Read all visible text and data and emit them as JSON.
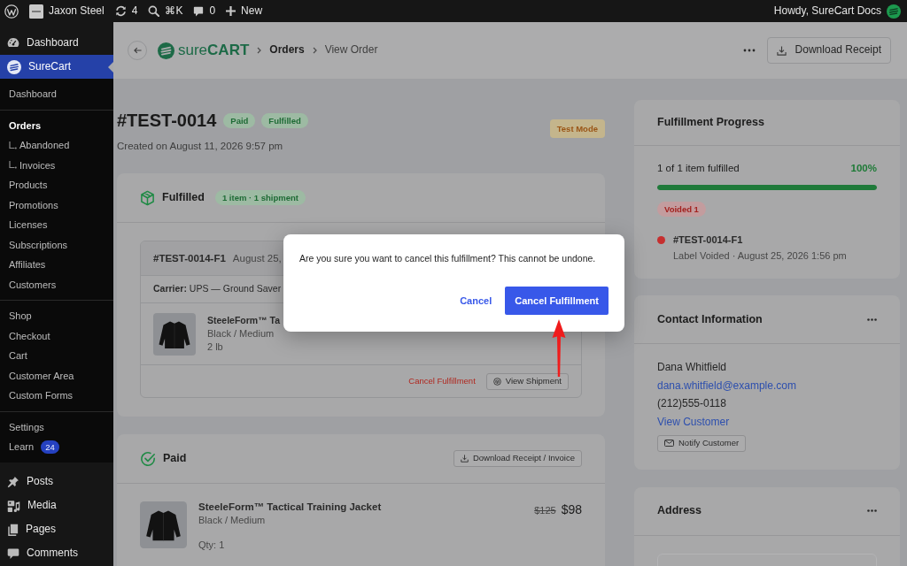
{
  "admin_bar": {
    "site_name": "Jaxon Steel",
    "updates": "4",
    "search_shortcut": "⌘K",
    "comments": "0",
    "new_label": "New",
    "greeting": "Howdy, SureCart Docs"
  },
  "sidebar": {
    "items": [
      {
        "label": "Dashboard",
        "selected": false
      },
      {
        "label": "SureCart",
        "selected": true,
        "submenu": [
          {
            "items": [
              {
                "label": "Dashboard",
                "selected": false
              }
            ]
          },
          {
            "items": [
              {
                "label": "Orders",
                "selected": true,
                "children": [
                  {
                    "label": "Abandoned",
                    "selected": false
                  },
                  {
                    "label": "Invoices",
                    "selected": false
                  }
                ]
              },
              {
                "label": "Products",
                "selected": false
              },
              {
                "label": "Promotions",
                "selected": false
              },
              {
                "label": "Licenses",
                "selected": false
              },
              {
                "label": "Subscriptions",
                "selected": false
              },
              {
                "label": "Affiliates",
                "selected": false
              },
              {
                "label": "Customers",
                "selected": false
              }
            ]
          },
          {
            "items": [
              {
                "label": "Shop",
                "selected": false
              },
              {
                "label": "Checkout",
                "selected": false
              },
              {
                "label": "Cart",
                "selected": false
              },
              {
                "label": "Customer Area",
                "selected": false
              },
              {
                "label": "Custom Forms",
                "selected": false
              }
            ]
          },
          {
            "items": [
              {
                "label": "Settings",
                "selected": false
              },
              {
                "label": "Learn",
                "selected": false,
                "badge": "24"
              }
            ]
          }
        ]
      },
      {
        "label": "Posts",
        "selected": false
      },
      {
        "label": "Media",
        "selected": false
      },
      {
        "label": "Pages",
        "selected": false
      },
      {
        "label": "Comments",
        "selected": false
      }
    ]
  },
  "header": {
    "logo_text": "sure**CART**",
    "breadcrumbs": [
      {
        "label": "Orders",
        "current": false
      },
      {
        "label": "View Order",
        "current": true
      }
    ],
    "download_button": "Download Receipt"
  },
  "order": {
    "number": "#TEST-0014",
    "badges": [
      "Paid",
      "Fulfilled"
    ],
    "mode_badge": "Test Mode",
    "created": "Created on August 11, 2026 9:57 pm"
  },
  "fulfilled_card": {
    "title": "Fulfilled",
    "pill": "1 item · 1 shipment",
    "shipment": {
      "id": "#TEST-0014-F1",
      "date": "August 25,",
      "carrier": "**Carrier:** UPS — Ground Saver",
      "item": {
        "name": "SteeleForm™ Ta",
        "variant": "Black / Medium",
        "weight": "2 lb"
      },
      "cancel_link": "Cancel Fulfillment",
      "view_button": "View Shipment"
    }
  },
  "paid_card": {
    "title": "Paid",
    "button": "Download Receipt / Invoice",
    "item": {
      "name": "SteeleForm™ Tactical Training Jacket",
      "variant": "Black / Medium",
      "qty": "Qty: 1",
      "original_price": "$125",
      "price": "$98"
    }
  },
  "progress_card": {
    "title": "Fulfillment Progress",
    "summary": "1 of 1 item fulfilled",
    "percent": "100%",
    "level": 1,
    "voided_badge": "Voided 1",
    "events": [
      {
        "id": "#TEST-0014-F1",
        "detail": "Label Voided · August 25, 2026 1:56 pm",
        "color": "#c62f2f"
      }
    ]
  },
  "contact_card": {
    "title": "Contact Information",
    "name": "Dana Whitfield",
    "email": "dana.whitfield@example.com",
    "phone": "(212)555-0118",
    "view_link": "View Customer",
    "notify_button": "Notify Customer"
  },
  "address_card": {
    "title": "Address"
  },
  "dialog": {
    "message": "Are you sure you want to cancel this fulfillment? This cannot be undone.",
    "cancel": "Cancel",
    "confirm": "Cancel Fulfillment"
  }
}
